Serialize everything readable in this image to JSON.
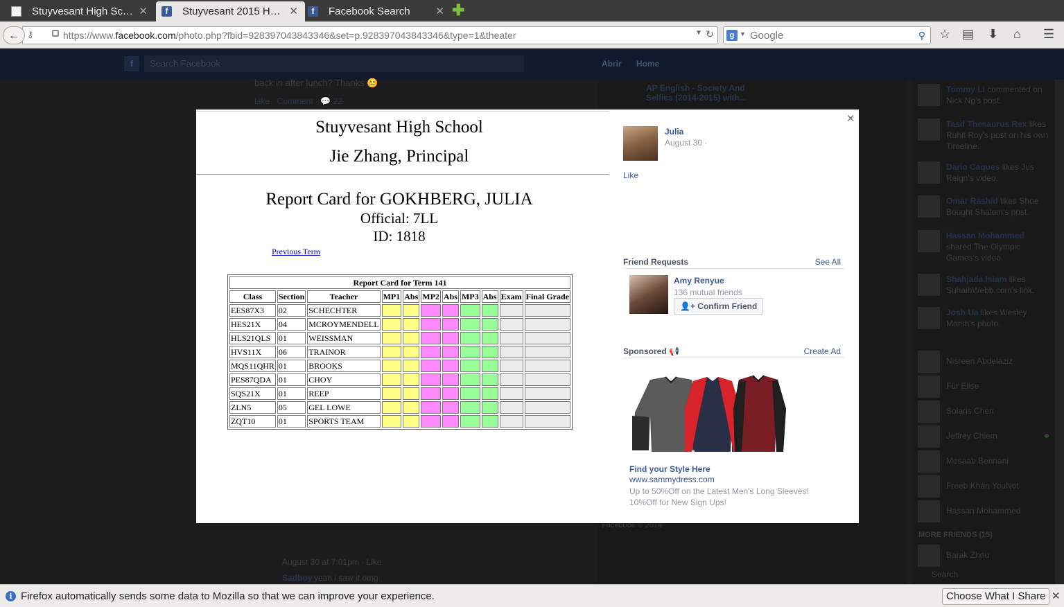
{
  "browser": {
    "tabs": [
      {
        "title": "Stuyvesant High Sch…",
        "active": false
      },
      {
        "title": "Stuyvesant 2015 Ho…",
        "active": true
      },
      {
        "title": "Facebook Search",
        "active": false
      }
    ],
    "url_prefix": "https://www.",
    "url_domain": "facebook.com",
    "url_path": "/photo.php?fbid=928397043843346&set=p.928397043843346&type=1&theater",
    "search_placeholder": "Google"
  },
  "fb_background": {
    "search_placeholder": "Search Facebook",
    "user_name": "Abrir",
    "home_label": "Home",
    "post_snippet": "back in after lunch? Thanks 😊",
    "post_actions": "Like · Comment · 💬 22",
    "group_title": "AP English - Society And Selfies (2014-2015) with...",
    "comment_time": "August 30 at 7:01pm · Like",
    "comment_author": "Sadboy",
    "comment_text": "yeah i saw it omg",
    "footer_text": "Facebook © 2014",
    "ticker": [
      {
        "name": "Tommy Li",
        "text": "commented on Nick Ng's post."
      },
      {
        "name": "Tasif Thesaurus Rex",
        "text": "likes Ruhit Roy's post on his own Timeline."
      },
      {
        "name": "Dario Caques",
        "text": "likes Jus Reign's video."
      },
      {
        "name": "Omar Rashid",
        "text": "likes Shoe Bought Shalom's post."
      },
      {
        "name": "Hassan Mohammed",
        "text": "shared The Olympic Games's video."
      },
      {
        "name": "Shahjada Islam",
        "text": "likes SuhaibWebb.com's link."
      },
      {
        "name": "Josh Ua",
        "text": "likes Wesley Marsh's photo."
      }
    ],
    "chat": [
      {
        "name": "Nisreen Abdelaziz"
      },
      {
        "name": "Für Elise"
      },
      {
        "name": "Solaris Chen"
      },
      {
        "name": "Jeffrey Chiem"
      },
      {
        "name": "Mosaab Bennani"
      },
      {
        "name": "Freeb Khan YouNot"
      },
      {
        "name": "Hassan Mohammed"
      }
    ],
    "more_friends": "MORE FRIENDS (15)",
    "more_chat": [
      {
        "name": "Barak Zhou"
      }
    ],
    "chat_search": "Search"
  },
  "photo": {
    "school": "Stuyvesant High School",
    "principal": "Jie Zhang, Principal",
    "report_title": "Report Card for GOKHBERG, JULIA",
    "official": "Official: 7LL",
    "id": "ID: 1818",
    "prev_term": "Previous Term",
    "table_caption": "Report Card for Term 141",
    "headers": [
      "Class",
      "Section",
      "Teacher",
      "MP1",
      "Abs",
      "MP2",
      "Abs",
      "MP3",
      "Abs",
      "Exam",
      "Final Grade"
    ],
    "rows": [
      {
        "class": "EES87X3",
        "section": "02",
        "teacher": "SCHECHTER"
      },
      {
        "class": "HES21X",
        "section": "04",
        "teacher": "MCROYMENDELL"
      },
      {
        "class": "HLS21QLS",
        "section": "01",
        "teacher": "WEISSMAN"
      },
      {
        "class": "HVS11X",
        "section": "06",
        "teacher": "TRAINOR"
      },
      {
        "class": "MQS11QHR",
        "section": "01",
        "teacher": "BROOKS"
      },
      {
        "class": "PES87QDA",
        "section": "01",
        "teacher": "CHOY"
      },
      {
        "class": "SQS21X",
        "section": "01",
        "teacher": "REEP"
      },
      {
        "class": "ZLN5",
        "section": "05",
        "teacher": "GEL LOWE"
      },
      {
        "class": "ZQT10",
        "section": "01",
        "teacher": "SPORTS TEAM"
      }
    ],
    "colors": {
      "mp1": "#ffff88",
      "mp2": "#ff88ff",
      "mp3": "#99ff99",
      "exam": "#ececec"
    }
  },
  "info": {
    "poster_name": "Julia",
    "poster_date": "August 30 ·",
    "like_label": "Like",
    "friend_requests_title": "Friend Requests",
    "see_all": "See All",
    "request_name": "Amy Renyue",
    "request_mutual": "136 mutual friends",
    "confirm_label": "Confirm Friend",
    "sponsored_title": "Sponsored",
    "create_ad": "Create Ad",
    "ad_title": "Find your Style Here",
    "ad_url": "www.sammydress.com",
    "ad_desc": "Up to 50%Off on the Latest Men's Long Sleeves! 10%Off for New Sign Ups!"
  },
  "notification": {
    "text": "Firefox automatically sends some data to Mozilla so that we can improve your experience.",
    "button": "Choose What I Share"
  }
}
